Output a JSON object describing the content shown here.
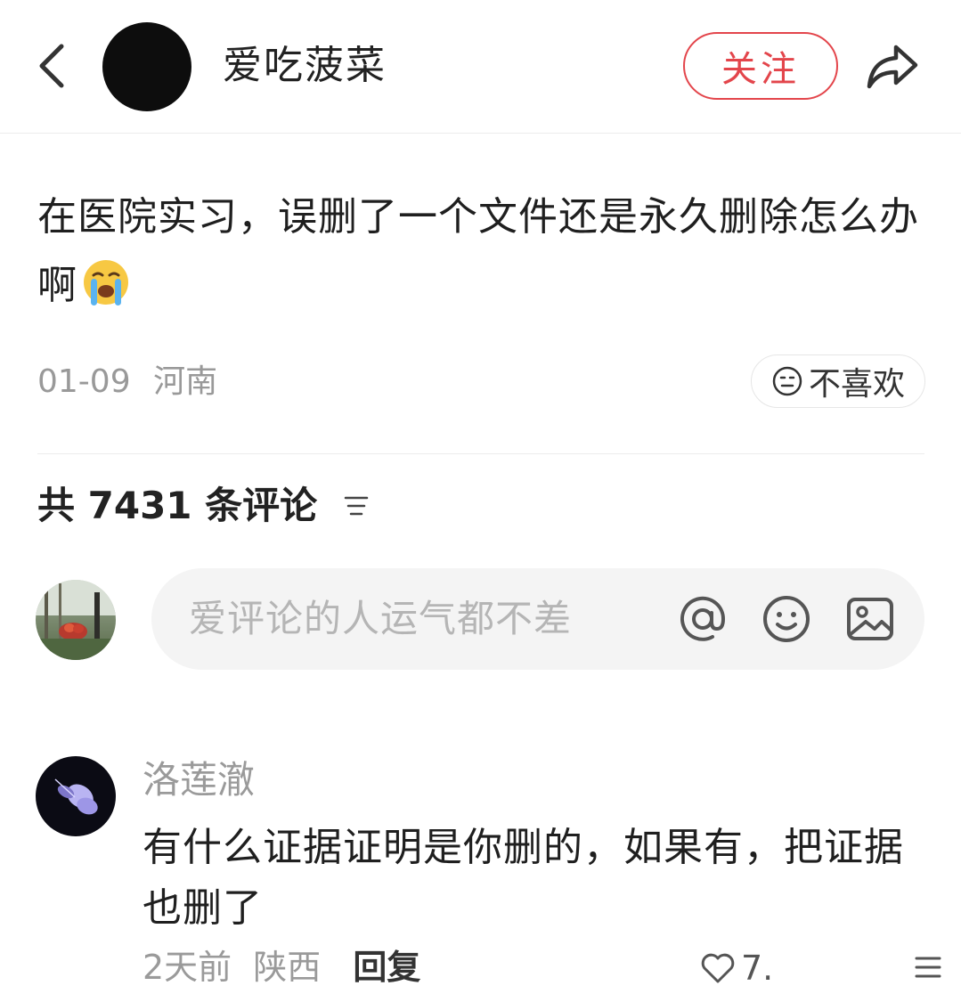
{
  "header": {
    "author_name": "爱吃菠菜",
    "follow_label": "关注"
  },
  "post": {
    "text": "在医院实习，误删了一个文件还是永久删除怎么办啊",
    "emoji": "loudly-crying-face",
    "date": "01-09",
    "location": "河南",
    "dislike_label": "不喜欢"
  },
  "comments_section": {
    "count_label": "共 7431 条评论",
    "input_placeholder": "爱评论的人运气都不差"
  },
  "comments": [
    {
      "user": "洛莲澈",
      "text": "有什么证据证明是你删的，如果有，把证据也删了",
      "time": "2天前",
      "location": "陕西",
      "reply_label": "回复",
      "likes": "7."
    }
  ],
  "colors": {
    "accent": "#e3454b",
    "muted_text": "#999999",
    "input_bg": "#f4f4f4"
  }
}
